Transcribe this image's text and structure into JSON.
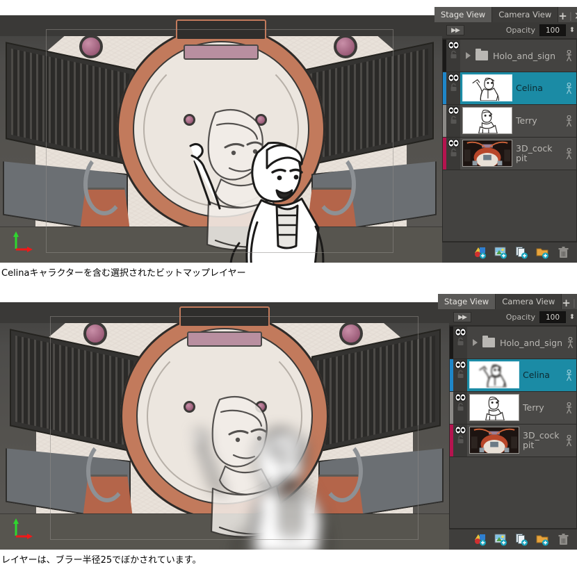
{
  "screenshots": [
    {
      "caption": "Celinaキャラクターを含む選択されたビットマップレイヤー",
      "tabs": [
        {
          "label": "Stage View",
          "active": true
        },
        {
          "label": "Camera View",
          "active": false
        }
      ],
      "window_buttons": {
        "add": "+",
        "separator": "|",
        "close": "✕"
      },
      "opacity": {
        "label": "Opacity",
        "value": "100",
        "expand_icon": "▶▶",
        "spinner": "⬍"
      },
      "layers": [
        {
          "name": "Holo_and_sign",
          "type": "folder",
          "selected": false,
          "color": "#1a1918",
          "expand_arrow": "▶"
        },
        {
          "name": "Celina",
          "type": "bitmap",
          "selected": true,
          "color": "#1f86c8",
          "blurred_thumb": false
        },
        {
          "name": "Terry",
          "type": "bitmap",
          "selected": false,
          "color": "#8b8986",
          "blurred_thumb": false
        },
        {
          "name": "3D_cock pit",
          "type": "image",
          "selected": false,
          "color": "#b5144f",
          "blurred_thumb": false
        }
      ],
      "bottom_toolbar": [
        {
          "name": "add-drawing-layer-icon",
          "label": "Add Drawing Layer"
        },
        {
          "name": "add-image-layer-icon",
          "label": "Add Image Layer"
        },
        {
          "name": "duplicate-layer-icon",
          "label": "Duplicate Layer"
        },
        {
          "name": "add-group-icon",
          "label": "Add Group"
        },
        {
          "name": "delete-layer-icon",
          "label": "Delete Layer"
        }
      ],
      "viewport": {
        "gizmo_x_axis": "X",
        "gizmo_y_axis": "Y"
      }
    },
    {
      "caption": "レイヤーは、ブラー半径25でぼかされています。",
      "tabs": [
        {
          "label": "Stage View",
          "active": true
        },
        {
          "label": "Camera View",
          "active": false
        }
      ],
      "window_buttons": {
        "add": "+",
        "separator": "|",
        "close": "✕"
      },
      "opacity": {
        "label": "Opacity",
        "value": "100",
        "expand_icon": "▶▶",
        "spinner": "⬍"
      },
      "layers": [
        {
          "name": "Holo_and_sign",
          "type": "folder",
          "selected": false,
          "color": "#1a1918",
          "expand_arrow": "▶"
        },
        {
          "name": "Celina",
          "type": "bitmap",
          "selected": true,
          "color": "#1f86c8",
          "blurred_thumb": true
        },
        {
          "name": "Terry",
          "type": "bitmap",
          "selected": false,
          "color": "#8b8986",
          "blurred_thumb": false
        },
        {
          "name": "3D_cock pit",
          "type": "image",
          "selected": false,
          "color": "#b5144f",
          "blurred_thumb": false
        }
      ],
      "bottom_toolbar": [
        {
          "name": "add-drawing-layer-icon",
          "label": "Add Drawing Layer"
        },
        {
          "name": "add-image-layer-icon",
          "label": "Add Image Layer"
        },
        {
          "name": "duplicate-layer-icon",
          "label": "Duplicate Layer"
        },
        {
          "name": "add-group-icon",
          "label": "Add Group"
        },
        {
          "name": "delete-layer-icon",
          "label": "Delete Layer"
        }
      ],
      "viewport": {
        "gizmo_x_axis": "X",
        "gizmo_y_axis": "Y"
      }
    }
  ],
  "colors": {
    "selection_teal": "#1b8ba5",
    "panel_bg": "#3f3e3c",
    "row_bg": "#4a4947",
    "accent_orange": "#c27a5c",
    "gizmo_green": "#2fd62f",
    "gizmo_red": "#f01818"
  }
}
